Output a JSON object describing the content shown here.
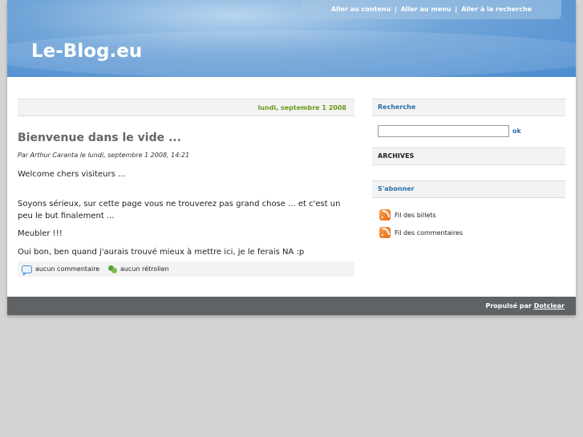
{
  "prelude": {
    "skip_content": "Aller au contenu",
    "skip_menu": "Aller au menu",
    "skip_search": "Aller à la recherche",
    "separator": "|"
  },
  "blog": {
    "title": "Le-Blog.eu"
  },
  "main": {
    "date": "lundi, septembre 1 2008",
    "post": {
      "title": "Bienvenue dans le vide ...",
      "info": "Par Arthur Caranta le lundi, septembre 1 2008, 14:21",
      "paragraphs": [
        "Welcome chers visiteurs ...",
        "Soyons sérieux, sur cette page vous ne trouverez pas grand chose ... et c'est un peu le but finalement ...",
        "Meubler !!!",
        "Oui bon, ben quand j'aurais trouvé mieux à mettre ici, je le ferais NA :p"
      ],
      "comments_link": "aucun commentaire",
      "trackbacks_link": "aucun rétrolien"
    }
  },
  "sidebar": {
    "search_title": "Recherche",
    "search_value": "",
    "search_button": "ok",
    "archives_title": "ARCHIVES",
    "subscribe_title": "S'abonner",
    "feeds": [
      "Fil des billets",
      "Fil des commentaires"
    ]
  },
  "footer": {
    "powered_by": "Propulsé par",
    "engine": "Dotclear"
  },
  "colors": {
    "header_blue": "#4a8bd0",
    "date_green": "#6a9a1a",
    "link_blue": "#2a6fa8",
    "footer_gray": "#5f6366",
    "rss_orange": "#e86b13"
  }
}
